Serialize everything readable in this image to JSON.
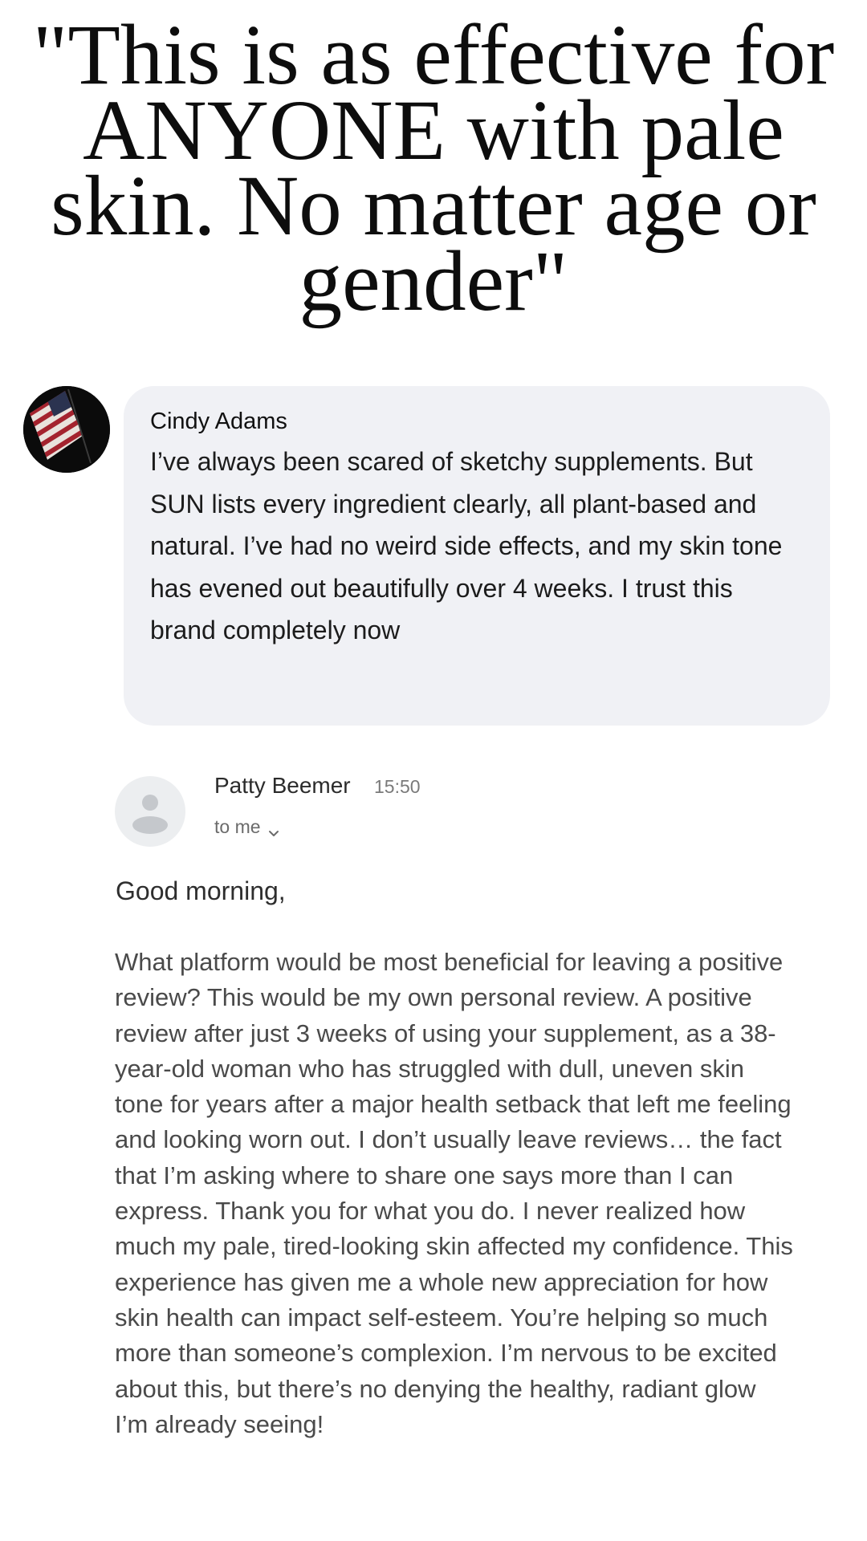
{
  "headline": {
    "text": "\"This is as effective for ANYONE with pale skin. No matter age or gender\""
  },
  "comment": {
    "avatar_icon": "american-flag-avatar",
    "author": "Cindy Adams",
    "text": "I’ve always been scared of sketchy supplements. But SUN lists every ingredient clearly, all plant-based and natural. I’ve had no weird side effects, and my skin tone has evened out beautifully over 4 weeks. I trust this brand completely now",
    "bubble_color": "#f0f1f5"
  },
  "email": {
    "avatar_icon": "default-user-icon",
    "sender": "Patty Beemer",
    "time": "15:50",
    "recipient_label": "to me",
    "recipient_icon": "chevron-down-icon",
    "greeting": "Good morning,",
    "body": "What platform would be most beneficial for leaving a positive review? This would be my own personal review. A positive review after just 3 weeks of using your supplement, as a 38-year-old woman who has struggled with dull, uneven skin tone for years after a major health setback that left me feeling and looking worn out. I don’t usually leave reviews… the fact that I’m asking where to share one says more than I can express. Thank you for what you do. I never realized how much my pale, tired-looking skin affected my confidence. This experience has given me a whole new appreciation for how skin health can impact self-esteem. You’re helping so much more than someone’s complexion. I’m nervous to be excited about this, but there’s no denying the healthy, radiant glow I’m already seeing!"
  }
}
